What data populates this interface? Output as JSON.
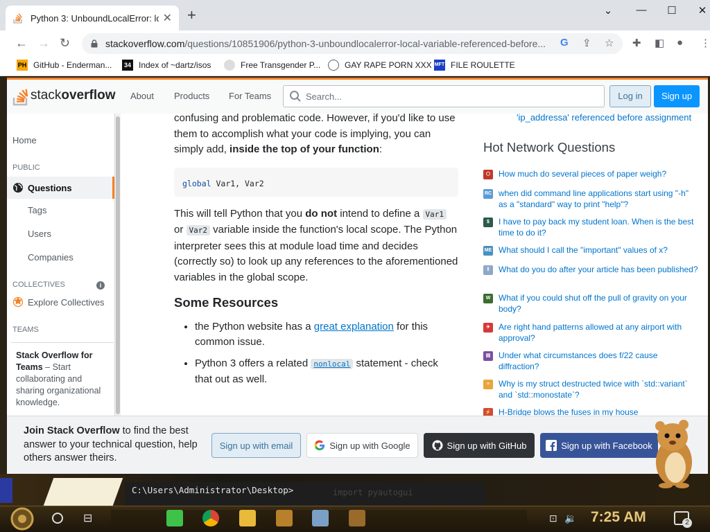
{
  "browser": {
    "tab_title": "Python 3: UnboundLocalError: lo",
    "new_tab": "+",
    "url_host": "stackoverflow.com",
    "url_path": "/questions/10851906/python-3-unboundlocalerror-local-variable-referenced-before...",
    "bookmarks": [
      {
        "label": "GitHub - Enderman...",
        "icon": "PH"
      },
      {
        "label": "Index of ~dartz/isos",
        "icon": "34"
      },
      {
        "label": "Free Transgender P...",
        "icon": "mask"
      },
      {
        "label": "GAY RAPE PORN XXX",
        "icon": "globe"
      },
      {
        "label": "FILE ROULETTE",
        "icon": "MFT"
      }
    ]
  },
  "so": {
    "logo_light": "stack",
    "logo_bold": "overflow",
    "nav": [
      "About",
      "Products",
      "For Teams"
    ],
    "search_placeholder": "Search...",
    "login": "Log in",
    "signup": "Sign up"
  },
  "leftnav": {
    "home": "Home",
    "public": "PUBLIC",
    "questions": "Questions",
    "tags": "Tags",
    "users": "Users",
    "companies": "Companies",
    "collectives": "COLLECTIVES",
    "explore": "Explore Collectives",
    "teams": "TEAMS",
    "teams_title": "Stack Overflow for Teams",
    "teams_dash": " – Start collaborating and sharing organizational knowledge."
  },
  "post": {
    "p1a": "confusing and problematic code. However, if you'd like to use them to accomplish what your code is implying, you can simply add, ",
    "p1b": "inside the top of your function",
    "p1c": ":",
    "code_kw": "global",
    "code_rest": " Var1, Var2",
    "p2a": "This will tell Python that you ",
    "p2b": "do not",
    "p2c": " intend to define a ",
    "p2code1": "Var1",
    "p2d": " or ",
    "p2code2": "Var2",
    "p2e": " variable inside the function's local scope. The Python interpreter sees this at module load time and decides (correctly so) to look up any references to the aforementioned variables in the global scope.",
    "h2": "Some Resources",
    "li1a": "the Python website has a ",
    "li1link": "great explanation",
    "li1b": " for this common issue.",
    "li2a": "Python 3 offers a related ",
    "li2code": "nonlocal",
    "li2b": " statement - check that out as well."
  },
  "sidebar": {
    "top_link": "'ip_addressa' referenced before assignment",
    "hnq_title": "Hot Network Questions",
    "questions": [
      {
        "text": "How much do several pieces of paper weigh?",
        "color": "#c0392b",
        "icon": "⬡"
      },
      {
        "text": "when did command line applications start using \"-h\" as a \"standard\" way to print \"help\"?",
        "color": "#5b9bd5",
        "icon": "RC"
      },
      {
        "text": "I have to pay back my student loan. When is the best time to do it?",
        "color": "#2c5a4a",
        "icon": "$"
      },
      {
        "text": "What should I call the \"important\" values of x?",
        "color": "#4a90c2",
        "icon": "ME"
      },
      {
        "text": "What do you do after your article has been published?",
        "color": "#8ea8c8",
        "icon": "‖"
      },
      {
        "text": "What if you could shut off the pull of gravity on your body?",
        "color": "#3b6d2e",
        "icon": "W"
      },
      {
        "text": "Are right hand patterns allowed at any airport with approval?",
        "color": "#d93838",
        "icon": "✈"
      },
      {
        "text": "Under what circumstances does f/22 cause diffraction?",
        "color": "#7a4fa0",
        "icon": "▤"
      },
      {
        "text": "Why is my struct destructed twice with `std::variant` and `std::monostate`?",
        "color": "#e8a53a",
        "icon": "≡"
      },
      {
        "text": "H-Bridge blows the fuses in my house",
        "color": "#d04a3a",
        "icon": "⚡"
      }
    ]
  },
  "banner": {
    "bold": "Join Stack Overflow",
    "rest": " to find the best answer to your technical question, help others answer theirs.",
    "email": "Sign up with email",
    "google": "Sign up with Google",
    "github": "Sign up with GitHub",
    "facebook": "Sign up with Facebook"
  },
  "desktop": {
    "terminal_prompt": "C:\\Users\\Administrator\\Desktop>",
    "ghost_text": "import pyautogui",
    "clock": "7:25 AM",
    "notif_count": "2"
  }
}
